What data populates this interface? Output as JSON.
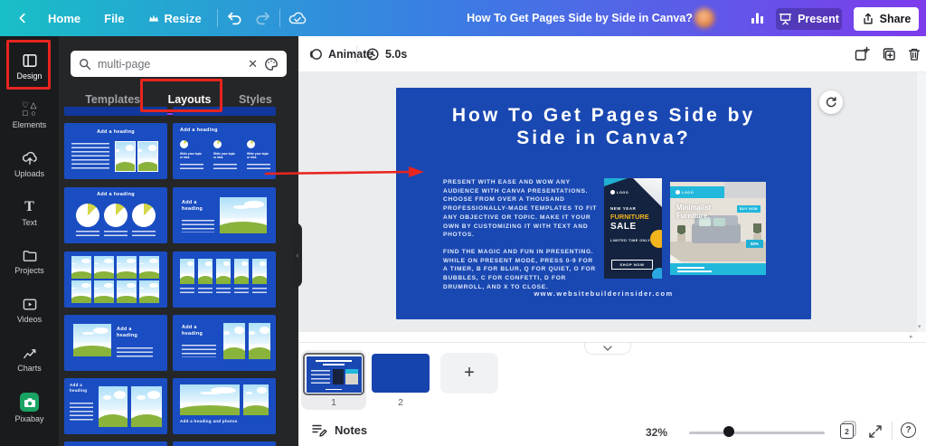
{
  "colors": {
    "topbar_gradient_start": "#18bfc7",
    "topbar_gradient_mid": "#3a7de3",
    "topbar_gradient_end": "#7d3bec",
    "accent_purple": "#8b3dff",
    "annotation_red": "#e8251f",
    "sidebar_bg": "#1a1b1d",
    "panel_bg": "#252628",
    "template_blue": "#1a4dc2",
    "slide_blue": "#1a48b2",
    "ad_navy": "#14233f",
    "ad_teal": "#22b8dc",
    "ad_yellow": "#f2b51d",
    "canvas_bg": "#ebecee"
  },
  "topbar": {
    "home": "Home",
    "file": "File",
    "resize": "Resize",
    "title": "How To Get Pages Side by Side in Canva?",
    "present": "Present",
    "share": "Share"
  },
  "sidebar": {
    "items": [
      {
        "label": "Design"
      },
      {
        "label": "Elements"
      },
      {
        "label": "Uploads"
      },
      {
        "label": "Text"
      },
      {
        "label": "Projects"
      },
      {
        "label": "Videos"
      },
      {
        "label": "Charts"
      },
      {
        "label": "Pixabay"
      }
    ]
  },
  "panel": {
    "search_value": "multi-page",
    "tabs": {
      "templates": "Templates",
      "layouts": "Layouts",
      "styles": "Styles"
    },
    "tpl": {
      "heading": "Add a heading",
      "heading_photos": "Add a heading and photos",
      "topic": "Write your topic or idea"
    }
  },
  "canvasbar": {
    "animate": "Animate",
    "duration": "5.0s"
  },
  "slide": {
    "title_line1": "How To Get Pages Side by",
    "title_line2": "Side in Canva?",
    "para1": "PRESENT WITH EASE AND WOW ANY AUDIENCE WITH CANVA PRESENTATIONS. CHOOSE FROM OVER A THOUSAND PROFESSIONALLY-MADE TEMPLATES TO FIT ANY OBJECTIVE OR TOPIC. MAKE IT YOUR OWN BY CUSTOMIZING IT WITH TEXT AND PHOTOS.",
    "para2": "FIND THE MAGIC AND FUN IN PRESENTING. WHILE ON PRESENT MODE, PRESS 0-9 FOR A TIMER, B FOR BLUR, Q FOR QUIET, O FOR BUBBLES, C FOR CONFETTI, D FOR DRUMROLL, AND X TO CLOSE.",
    "url": "www.websitebuilderinsider.com",
    "ad1": {
      "logo": "LOGO",
      "kicker": "NEW YEAR",
      "word1": "FURNITURE",
      "word2": "SALE",
      "sub": "LIMITED TIME ONLY",
      "cta": "SHOP NOW"
    },
    "ad2": {
      "logo": "LOGO",
      "title": "Minimalist Furniture.",
      "cta": "BUY NOW",
      "badge": "50%"
    }
  },
  "pagesbar": {
    "page1": "1",
    "page2": "2",
    "page_count": "2",
    "notes": "Notes",
    "zoom_level": "32%"
  }
}
